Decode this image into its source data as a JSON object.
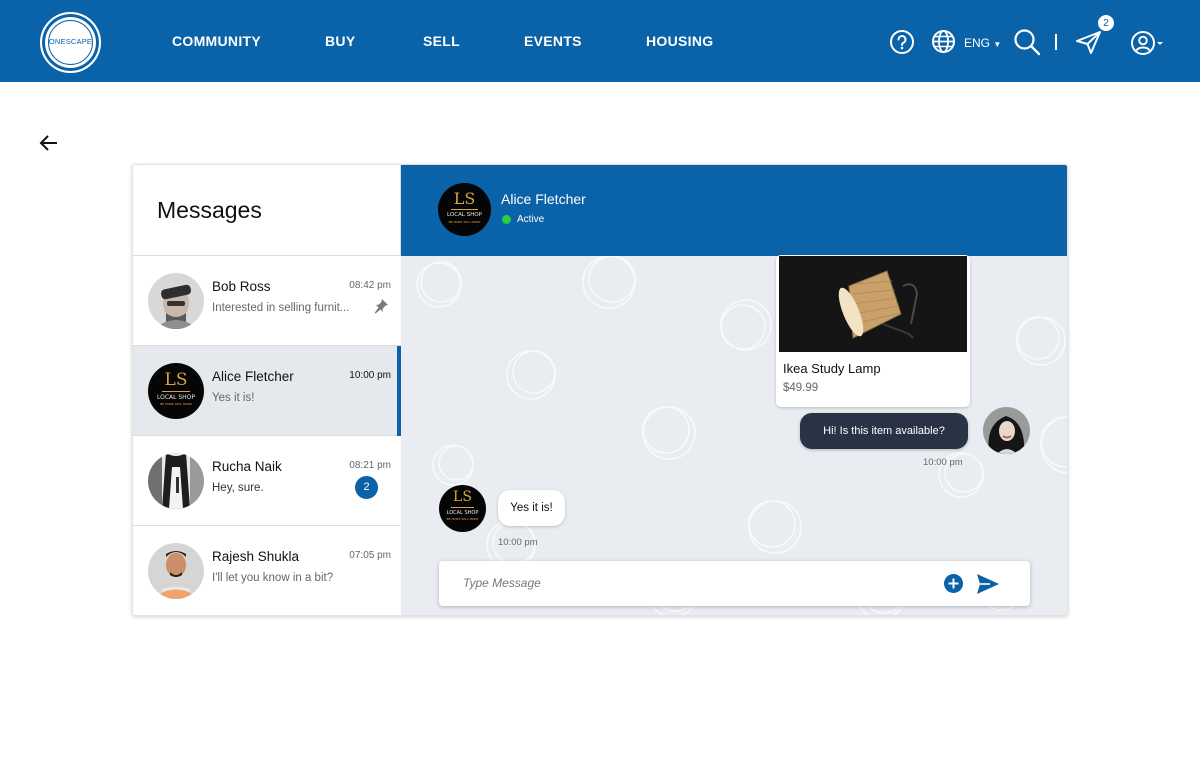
{
  "brand": {
    "logo_text": "ONESCAPE"
  },
  "nav": {
    "links": [
      "COMMUNITY",
      "BUY",
      "SELL",
      "EVENTS",
      "HOUSING"
    ],
    "language": "ENG",
    "notification_count": "2",
    "icons": [
      "help-icon",
      "globe-icon",
      "search-icon",
      "send-icon",
      "user-icon"
    ]
  },
  "messages": {
    "title": "Messages",
    "conversations": [
      {
        "name": "Bob Ross",
        "time": "08:42 pm",
        "preview": "Interested in selling furnit...",
        "pinned": true
      },
      {
        "name": "Alice Fletcher",
        "time": "10:00 pm",
        "preview": "Yes it is!",
        "active": true
      },
      {
        "name": "Rucha Naik",
        "time": "08:21 pm",
        "preview": "Hey, sure.",
        "unread": "2"
      },
      {
        "name": "Rajesh Shukla",
        "time": "07:05 pm",
        "preview": "I'll let you know in a bit?"
      }
    ]
  },
  "chat": {
    "contact_name": "Alice Fletcher",
    "status": "Active",
    "avatar": {
      "mark": "LS",
      "name": "LOCAL SHOP",
      "tagline": "BE MORE SELL MORE"
    },
    "product": {
      "name": "Ikea Study Lamp",
      "price": "$49.99"
    },
    "outgoing": {
      "text": "Hi! Is this item available?",
      "time": "10:00 pm"
    },
    "incoming": {
      "text": "Yes it is!",
      "time": "10:00 pm"
    },
    "composer_placeholder": "Type Message"
  },
  "colors": {
    "primary": "#0a62a8",
    "outgoing_bubble": "#2a3245",
    "chat_bg": "#e9edf1",
    "status_active": "#2ecc40"
  }
}
